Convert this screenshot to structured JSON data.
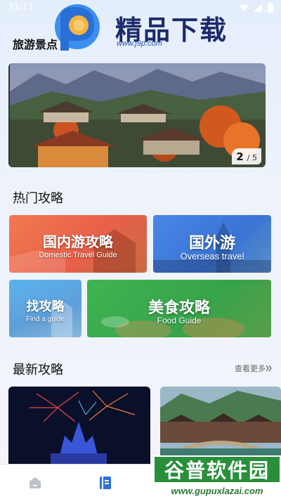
{
  "status_bar": {
    "time": "11:13",
    "icons": [
      "wifi-icon",
      "signal-icon",
      "battery-icon"
    ]
  },
  "watermark_top": {
    "title": "精品下载",
    "url": "www.j9p.com"
  },
  "top_section": {
    "title": "旅游景点"
  },
  "banner": {
    "current": "2",
    "total": "5",
    "separator_total": "/ 5"
  },
  "hot_section": {
    "title": "热门攻略"
  },
  "guide_cards": {
    "domestic": {
      "cn": "国内游攻略",
      "en": "Domestic Travel Guide"
    },
    "overseas": {
      "cn": "国外游",
      "en": "Overseas travel"
    },
    "find": {
      "cn": "找攻略",
      "en": "Find a guide"
    },
    "food": {
      "cn": "美食攻略",
      "en": "Food Guide"
    }
  },
  "latest_section": {
    "title": "最新攻略",
    "see_more": "查看更多"
  },
  "bottom_nav": {
    "items": [
      {
        "icon": "home-icon"
      },
      {
        "icon": "guide-list-icon"
      }
    ]
  },
  "watermark_bottom": {
    "title": "谷普软件园",
    "url": "www.gupuxlazai.com"
  },
  "colors": {
    "accent_blue": "#2f6fe0",
    "domestic": "#f27a4f",
    "overseas": "#4a86e8",
    "find": "#5ab2ef",
    "food": "#3fb452",
    "watermark_green": "#2a8f3a"
  }
}
